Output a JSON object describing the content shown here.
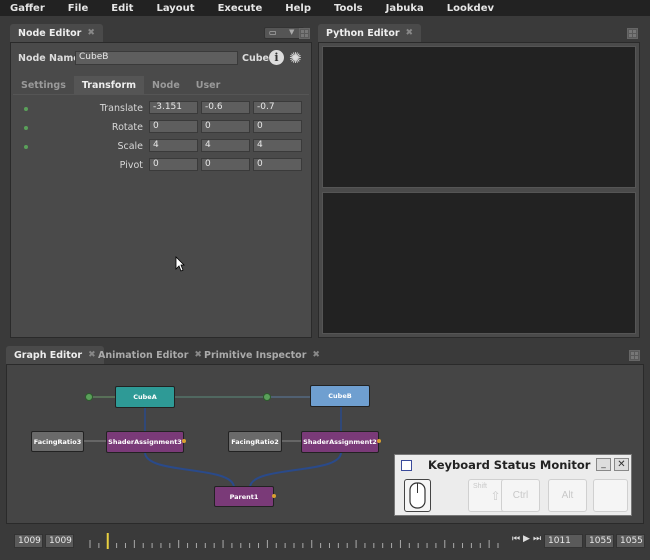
{
  "menubar": [
    "Gaffer",
    "File",
    "Edit",
    "Layout",
    "Execute",
    "Help",
    "Tools",
    "Jabuka",
    "Lookdev"
  ],
  "node_editor": {
    "tab": "Node Editor",
    "node_name_label": "Node Name",
    "node_name_value": "CubeB",
    "node_type": "Cube",
    "subtabs": [
      "Settings",
      "Transform",
      "Node",
      "User"
    ],
    "active_subtab": "Transform",
    "rows": [
      {
        "label": "Translate",
        "x": "-3.151",
        "y": "-0.6",
        "z": "-0.7"
      },
      {
        "label": "Rotate",
        "x": "0",
        "y": "0",
        "z": "0"
      },
      {
        "label": "Scale",
        "x": "4",
        "y": "4",
        "z": "4"
      },
      {
        "label": "Pivot",
        "x": "0",
        "y": "0",
        "z": "0"
      }
    ]
  },
  "python_editor": {
    "tab": "Python Editor"
  },
  "bottom_tabs": [
    "Graph Editor",
    "Animation Editor",
    "Primitive Inspector"
  ],
  "graph": {
    "nodes": {
      "cubeA": "CubeA",
      "cubeB": "CubeB",
      "facing3": "FacingRatio3",
      "facing2": "FacingRatio2",
      "shader3": "ShaderAssignment3",
      "shader2": "ShaderAssignment2",
      "parent": "Parent1"
    },
    "colors": {
      "teal": "#2e9a96",
      "blue": "#6f9fd0",
      "purple": "#7a3a78",
      "gray": "#6a6a6a"
    }
  },
  "keyboard_monitor": {
    "title": "Keyboard Status Monitor",
    "keys": [
      "Shift",
      "Ctrl",
      "Alt",
      ""
    ]
  },
  "timeline": {
    "start_outer": "1009",
    "start_inner": "1009",
    "current": "1011",
    "end_inner": "1055",
    "end_outer": "1055"
  }
}
